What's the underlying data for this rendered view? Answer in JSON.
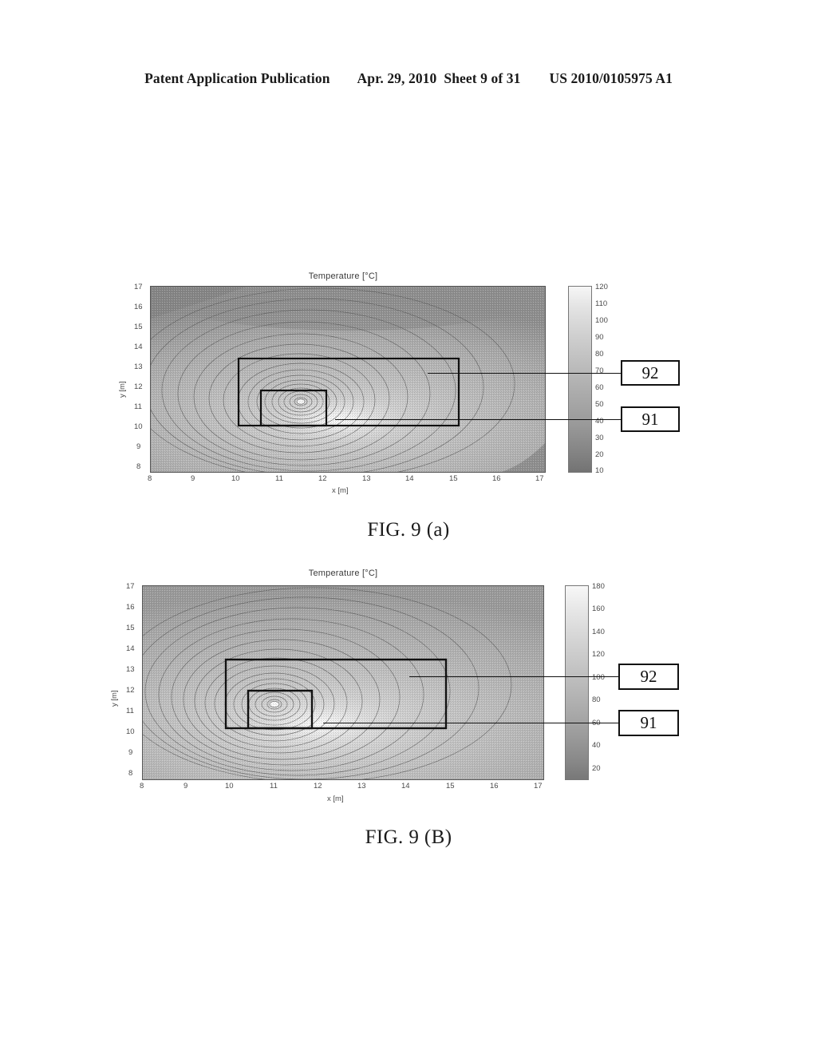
{
  "header": {
    "publication": "Patent Application Publication",
    "date": "Apr. 29, 2010",
    "sheet": "Sheet 9 of 31",
    "pub_number": "US 2010/0105975 A1"
  },
  "figures": [
    {
      "id": "a",
      "caption": "FIG. 9 (a)",
      "callouts": [
        {
          "label": "92"
        },
        {
          "label": "91"
        }
      ]
    },
    {
      "id": "b",
      "caption": "FIG. 9 (B)",
      "callouts": [
        {
          "label": "92"
        },
        {
          "label": "91"
        }
      ]
    }
  ],
  "chart_data": [
    {
      "type": "heatmap",
      "title": "Temperature [°C]",
      "xlabel": "x [m]",
      "ylabel": "y [m]",
      "xlim": [
        8,
        17
      ],
      "ylim": [
        8,
        17
      ],
      "xticks": [
        8,
        9,
        10,
        11,
        12,
        13,
        14,
        15,
        16,
        17
      ],
      "yticks": [
        8,
        9,
        10,
        11,
        12,
        13,
        14,
        15,
        16,
        17
      ],
      "colorbar": {
        "label": "Temperature [°C]",
        "min": 10,
        "max": 120,
        "ticks": [
          10,
          20,
          30,
          40,
          50,
          60,
          70,
          80,
          90,
          100,
          110,
          120
        ]
      },
      "grid": false,
      "legend": "none",
      "annotations": [
        {
          "label": "92",
          "shape": "rectangle",
          "x0": 10.0,
          "y0": 10.0,
          "x1": 15.0,
          "y1": 13.0
        },
        {
          "label": "91",
          "shape": "rectangle",
          "x0": 10.5,
          "y0": 10.0,
          "x1": 12.0,
          "y1": 11.3
        }
      ],
      "hot_spot": {
        "x": 11.2,
        "y": 10.6,
        "peak_temperature": 120
      },
      "description": "Contour map of temperature field; warmest near x=11.2 m, y=10.6 m, decaying outward to about 10 °C at corners"
    },
    {
      "type": "heatmap",
      "title": "Temperature [°C]",
      "xlabel": "x [m]",
      "ylabel": "y [m]",
      "xlim": [
        8,
        17
      ],
      "ylim": [
        8,
        17
      ],
      "xticks": [
        8,
        9,
        10,
        11,
        12,
        13,
        14,
        15,
        16,
        17
      ],
      "yticks": [
        8,
        9,
        10,
        11,
        12,
        13,
        14,
        15,
        16,
        17
      ],
      "colorbar": {
        "label": "Temperature [°C]",
        "min": 10,
        "max": 180,
        "ticks": [
          20,
          40,
          60,
          80,
          100,
          120,
          140,
          160,
          180
        ]
      },
      "grid": false,
      "legend": "none",
      "annotations": [
        {
          "label": "92",
          "shape": "rectangle",
          "x0": 10.0,
          "y0": 10.0,
          "x1": 15.0,
          "y1": 13.0
        },
        {
          "label": "91",
          "shape": "rectangle",
          "x0": 10.5,
          "y0": 10.0,
          "x1": 12.0,
          "y1": 11.4
        }
      ],
      "hot_spot": {
        "x": 11.2,
        "y": 10.7,
        "peak_temperature": 180
      },
      "description": "Contour map of temperature field with higher peak; concentric contours centered near x=11.2 m, y=10.7 m"
    }
  ]
}
